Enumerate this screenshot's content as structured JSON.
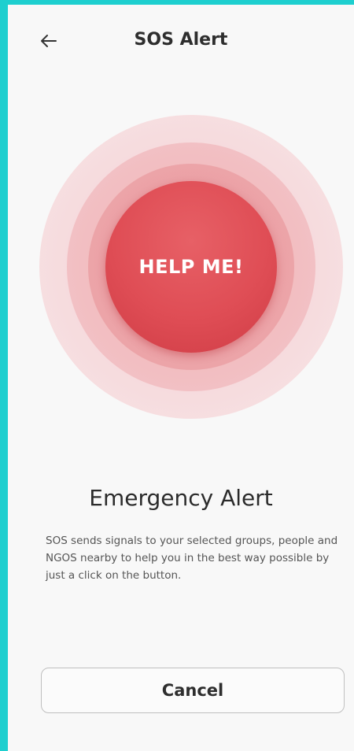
{
  "header": {
    "back_icon": "arrow-left-icon",
    "title": "SOS Alert"
  },
  "sos": {
    "button_label": "HELP ME!"
  },
  "alert": {
    "title": "Emergency Alert",
    "description": "SOS sends signals to your selected groups, people and NGOS nearby to help you in the best way possible by just a click on the button."
  },
  "footer": {
    "cancel_label": "Cancel"
  },
  "colors": {
    "border_accent": "#1ecfcf",
    "sos_red": "#df4d55",
    "background": "#f8f8f8"
  }
}
